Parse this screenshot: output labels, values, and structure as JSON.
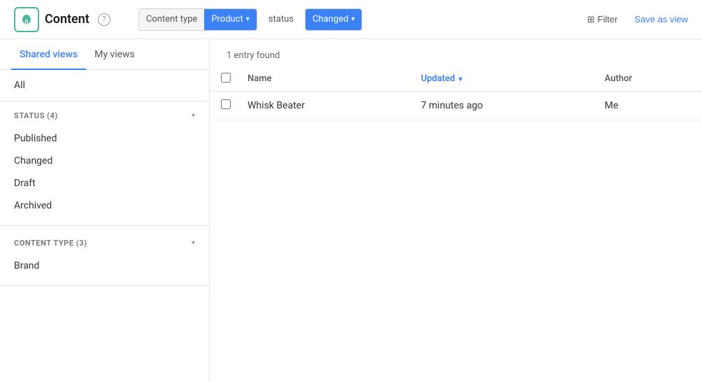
{
  "header": {
    "title": "Content",
    "help_label": "?",
    "filter": {
      "content_type_label": "Content type",
      "product_value": "Product",
      "status_label": "status",
      "changed_value": "Changed"
    },
    "filter_button": "Filter",
    "save_as_view": "Save as view"
  },
  "sidebar": {
    "tab_shared": "Shared views",
    "tab_my": "My views",
    "all_label": "All",
    "sections": [
      {
        "id": "status",
        "title": "STATUS (4)",
        "items": [
          "Published",
          "Changed",
          "Draft",
          "Archived"
        ]
      },
      {
        "id": "content_type",
        "title": "CONTENT TYPE (3)",
        "items": [
          "Brand"
        ]
      }
    ]
  },
  "content": {
    "entry_count": "1 entry found",
    "columns": [
      {
        "id": "name",
        "label": "Name",
        "sorted": false
      },
      {
        "id": "updated",
        "label": "Updated",
        "sorted": true
      },
      {
        "id": "author",
        "label": "Author",
        "sorted": false
      }
    ],
    "rows": [
      {
        "name": "Whisk Beater",
        "updated": "7 minutes ago",
        "author": "Me"
      }
    ]
  },
  "icons": {
    "logo_leaf": "🌿",
    "chevron_down": "▾",
    "filter": "≡",
    "sort_down": "▾"
  }
}
